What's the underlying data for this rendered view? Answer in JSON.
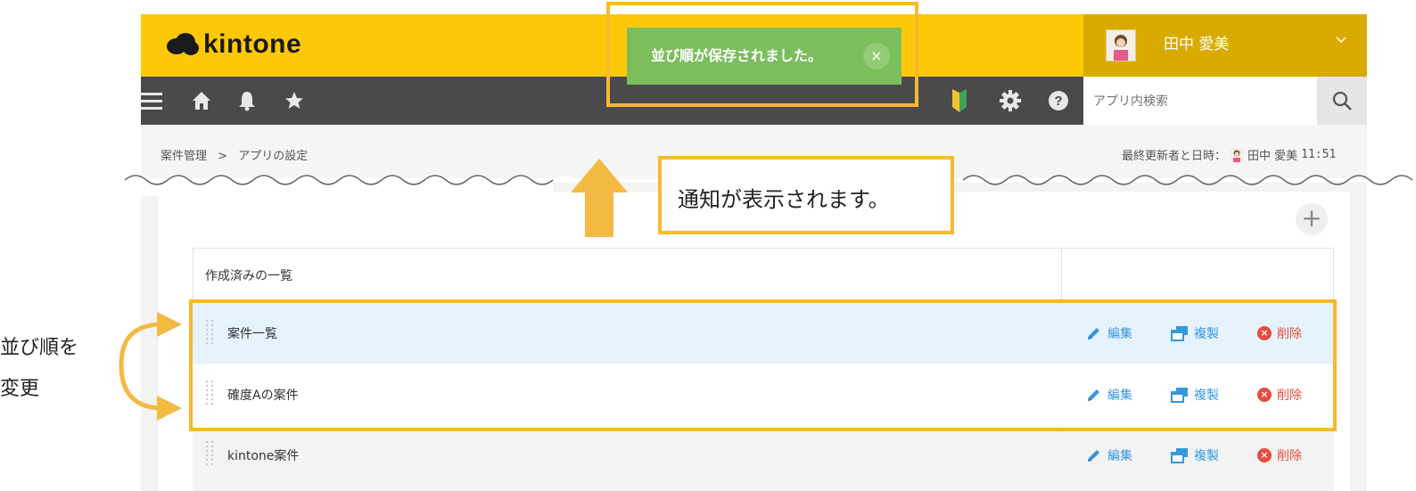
{
  "header": {
    "logo_text": "kintone",
    "user_name": "田中 愛美",
    "user_menu_icon": "chevron-down-icon"
  },
  "toolbar": {
    "icons": [
      "menu-icon",
      "home-icon",
      "bell-icon",
      "star-icon",
      "beginner-mark-icon",
      "gear-icon",
      "help-icon"
    ],
    "search_placeholder": "アプリ内検索",
    "search_icon": "search-icon"
  },
  "notification": {
    "text": "並び順が保存されました。",
    "close_label": "×"
  },
  "breadcrumb": {
    "app": "案件管理",
    "separator": ">",
    "current": "アプリの設定"
  },
  "updater": {
    "label": "最終更新者と日時：",
    "name": "田中 愛美",
    "time": "11:51"
  },
  "callout": {
    "text": "通知が表示されます。"
  },
  "annotation": {
    "line1": "並び順を",
    "line2": "変更"
  },
  "table": {
    "header": "作成済みの一覧",
    "rows": [
      {
        "name": "案件一覧",
        "highlighted": true
      },
      {
        "name": "確度Aの案件",
        "highlighted": false
      },
      {
        "name": "kintone案件",
        "highlighted": false
      }
    ],
    "actions": {
      "edit": "編集",
      "duplicate": "複製",
      "delete": "削除"
    }
  },
  "colors": {
    "brand_yellow": "#fdc80a",
    "toolbar_dark": "#4a4a4a",
    "notice_green": "#7cbd5c",
    "highlight_orange": "#f7b92e",
    "link_blue": "#3498db",
    "delete_red": "#e74c3c"
  }
}
